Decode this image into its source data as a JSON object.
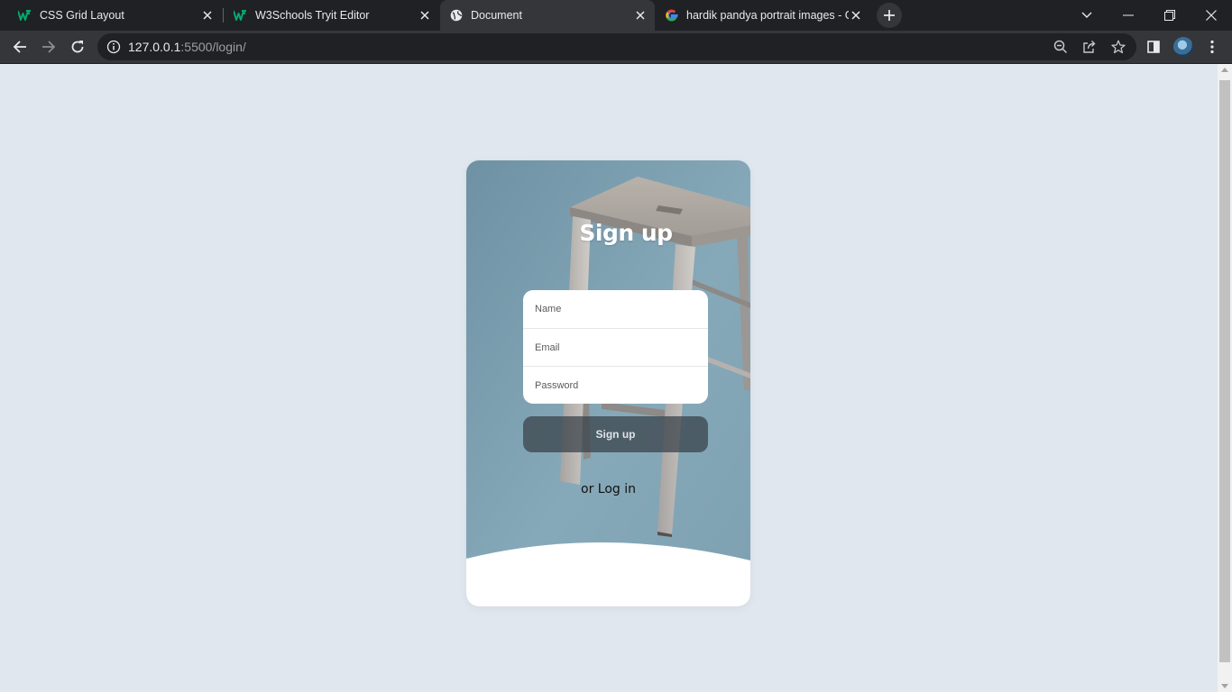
{
  "browser": {
    "tabs": [
      {
        "title": "CSS Grid Layout",
        "icon": "w3schools-favicon-icon",
        "active": false
      },
      {
        "title": "W3Schools Tryit Editor",
        "icon": "w3schools-favicon-icon",
        "active": false
      },
      {
        "title": "Document",
        "icon": "globe-icon",
        "active": true
      },
      {
        "title": "hardik pandya portrait images - G",
        "icon": "google-favicon-icon",
        "active": false
      }
    ],
    "url_host": "127.0.0.1",
    "url_rest": ":5500/login/",
    "colors": {
      "tabstrip": "#202124",
      "toolbar": "#35363a",
      "omnibox": "#202124"
    }
  },
  "page": {
    "background": "#e0e7ef",
    "card": {
      "title": "Sign up",
      "fields": [
        {
          "name": "name",
          "placeholder": "Name",
          "value": ""
        },
        {
          "name": "email",
          "placeholder": "Email",
          "value": ""
        },
        {
          "name": "password",
          "placeholder": "Password",
          "value": ""
        }
      ],
      "submit_label": "Sign up",
      "login_prefix": "or",
      "login_link": "Log in",
      "colors": {
        "photo_backdrop": "#7fa3b4",
        "button": "#374046"
      }
    }
  }
}
